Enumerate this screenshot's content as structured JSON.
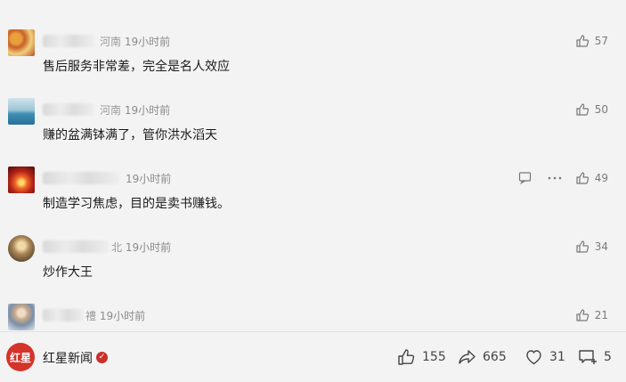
{
  "comments": [
    {
      "location": "河南",
      "time": "19小时前",
      "text": "售后服务非常差，完全是名人效应",
      "likes": "57"
    },
    {
      "location": "河南",
      "time": "19小时前",
      "text": "赚的盆满钵满了，管你洪水滔天",
      "likes": "50"
    },
    {
      "location": "",
      "time": "19小时前",
      "text": "制造学习焦虑，目的是卖书赚钱。",
      "likes": "49"
    },
    {
      "location": "北",
      "time": "19小时前",
      "text": "炒作大王",
      "likes": "34"
    },
    {
      "location": "禮",
      "time": "19小时前",
      "text": "",
      "likes": "21"
    }
  ],
  "footer": {
    "brand_name": "红星新闻",
    "logo_text": "红星",
    "likes": "155",
    "shares": "665",
    "favorites": "31",
    "comments": "5"
  },
  "icons": {
    "like": "thumbs-up-icon",
    "reply": "comment-bubble-icon",
    "more": "more-dots-icon",
    "share": "share-arrow-icon",
    "favorite": "heart-icon",
    "comment": "comment-plus-icon",
    "verified": "verified-badge-icon"
  },
  "colors": {
    "background": "#f3f3f3",
    "brand_red": "#d6332a",
    "text": "#1a1a1a",
    "meta": "#8a8a8a"
  }
}
